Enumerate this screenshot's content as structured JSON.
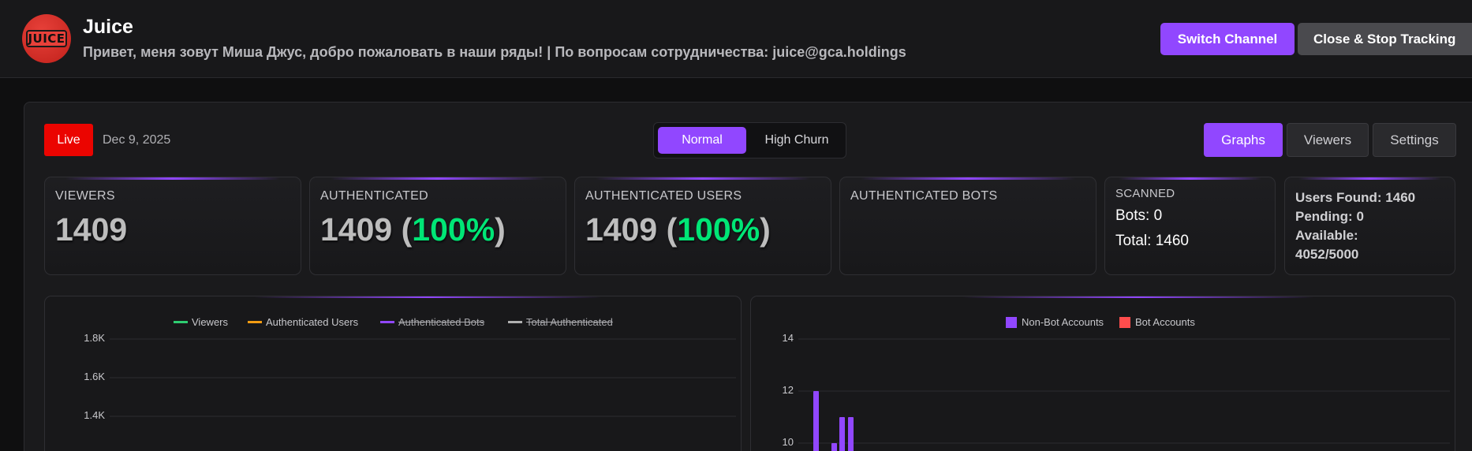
{
  "header": {
    "channel_name": "Juice",
    "logo_text": "JUICE",
    "description": "Привет, меня зовут Миша Джус, добро пожаловать в наши ряды! | По вопросам сотрудничества: juice@gca.holdings",
    "switch_label": "Switch Channel",
    "close_label": "Close & Stop Tracking"
  },
  "status": {
    "live_label": "Live",
    "date": "Dec 9, 2025"
  },
  "mode": {
    "normal_label": "Normal",
    "churn_label": "High Churn",
    "selected": "Normal"
  },
  "tabs": {
    "graphs": "Graphs",
    "viewers": "Viewers",
    "settings": "Settings",
    "active": "Graphs"
  },
  "cards": {
    "viewers": {
      "label": "VIEWERS",
      "value": "1409"
    },
    "authenticated": {
      "label": "AUTHENTICATED",
      "value": "1409",
      "pct": "100%"
    },
    "authenticated_users": {
      "label": "AUTHENTICATED USERS",
      "value": "1409",
      "pct": "100%"
    },
    "authenticated_bots": {
      "label": "AUTHENTICATED BOTS"
    },
    "scanned": {
      "label": "SCANNED",
      "bots": "Bots: 0",
      "total": "Total: 1460"
    },
    "info": {
      "users_found": "Users Found: 1460",
      "pending": "Pending: 0",
      "available_label": "Available:",
      "available_value": "4052/5000"
    }
  },
  "colors": {
    "accent": "#9147ff",
    "live": "#eb0400",
    "percent": "#00e676",
    "viewers_series": "#2ecc71",
    "auth_users_series": "#f39c12",
    "auth_bots_series": "#9147ff",
    "total_auth_series": "#b0b0b0",
    "bot_accounts": "#ff4d4d"
  },
  "chart_data": [
    {
      "type": "line",
      "legend": [
        "Viewers",
        "Authenticated Users",
        "Authenticated Bots",
        "Total Authenticated"
      ],
      "hidden_series": [
        "Authenticated Bots",
        "Total Authenticated"
      ],
      "y_ticks": [
        "1.8K",
        "1.6K",
        "1.4K"
      ],
      "ylim": [
        1400,
        1800
      ],
      "legend_position": "top",
      "grid": true
    },
    {
      "type": "bar",
      "legend": [
        "Non-Bot Accounts",
        "Bot Accounts"
      ],
      "y_ticks": [
        "14",
        "12",
        "10"
      ],
      "ylim": [
        10,
        14
      ],
      "legend_position": "top",
      "grid": true,
      "series": [
        {
          "name": "Non-Bot Accounts",
          "values": [
            12,
            10,
            11,
            11
          ]
        }
      ]
    }
  ]
}
